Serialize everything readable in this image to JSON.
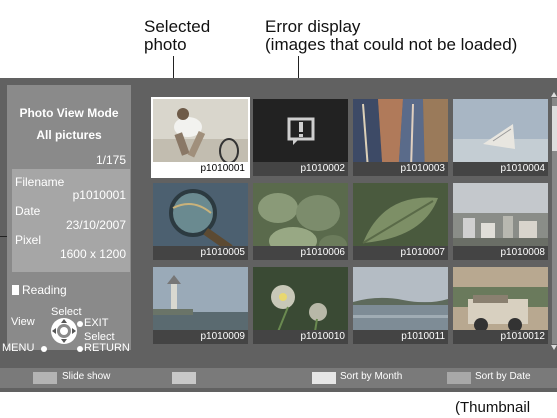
{
  "callouts": {
    "selected_photo": "Selected\nphoto",
    "error_display": "Error display\n(images that could not be loaded)",
    "footer_caption": "(Thumbnail"
  },
  "sidebar": {
    "title_line1": "Photo View Mode",
    "title_line2": "All pictures",
    "counter": "1/175",
    "filename_label": "Filename",
    "filename_value": "p1010001",
    "date_label": "Date",
    "date_value": "23/10/2007",
    "pixel_label": "Pixel",
    "pixel_value": "1600 x 1200",
    "reading_label": "Reading",
    "controls": {
      "select_top": "Select",
      "view": "View",
      "exit": "EXIT",
      "select_right": "Select",
      "menu": "MENU",
      "return": "RETURN"
    }
  },
  "thumbnails": [
    {
      "name": "p1010001",
      "icon": "tennis-player-photo",
      "selected": true
    },
    {
      "name": "p1010002",
      "icon": "error-icon",
      "selected": false
    },
    {
      "name": "p1010003",
      "icon": "fabric-photo",
      "selected": false
    },
    {
      "name": "p1010004",
      "icon": "seashell-photo",
      "selected": false
    },
    {
      "name": "p1010005",
      "icon": "magnifier-photo",
      "selected": false
    },
    {
      "name": "p1010006",
      "icon": "leaves-photo",
      "selected": false
    },
    {
      "name": "p1010007",
      "icon": "leaf-photo",
      "selected": false
    },
    {
      "name": "p1010008",
      "icon": "city-photo",
      "selected": false
    },
    {
      "name": "p1010009",
      "icon": "lighthouse-photo",
      "selected": false
    },
    {
      "name": "p1010010",
      "icon": "flowers-photo",
      "selected": false
    },
    {
      "name": "p1010011",
      "icon": "lake-photo",
      "selected": false
    },
    {
      "name": "p1010012",
      "icon": "vehicle-photo",
      "selected": false
    }
  ],
  "bottom_bar": {
    "blue_label": "Slide show",
    "red_label": "",
    "green_label": "Sort by Month",
    "yellow_label": "Sort by Date"
  },
  "colors": {
    "screen_bg": "#616161",
    "panel_bg": "#8a8a8a",
    "selection": "#ffffff"
  }
}
